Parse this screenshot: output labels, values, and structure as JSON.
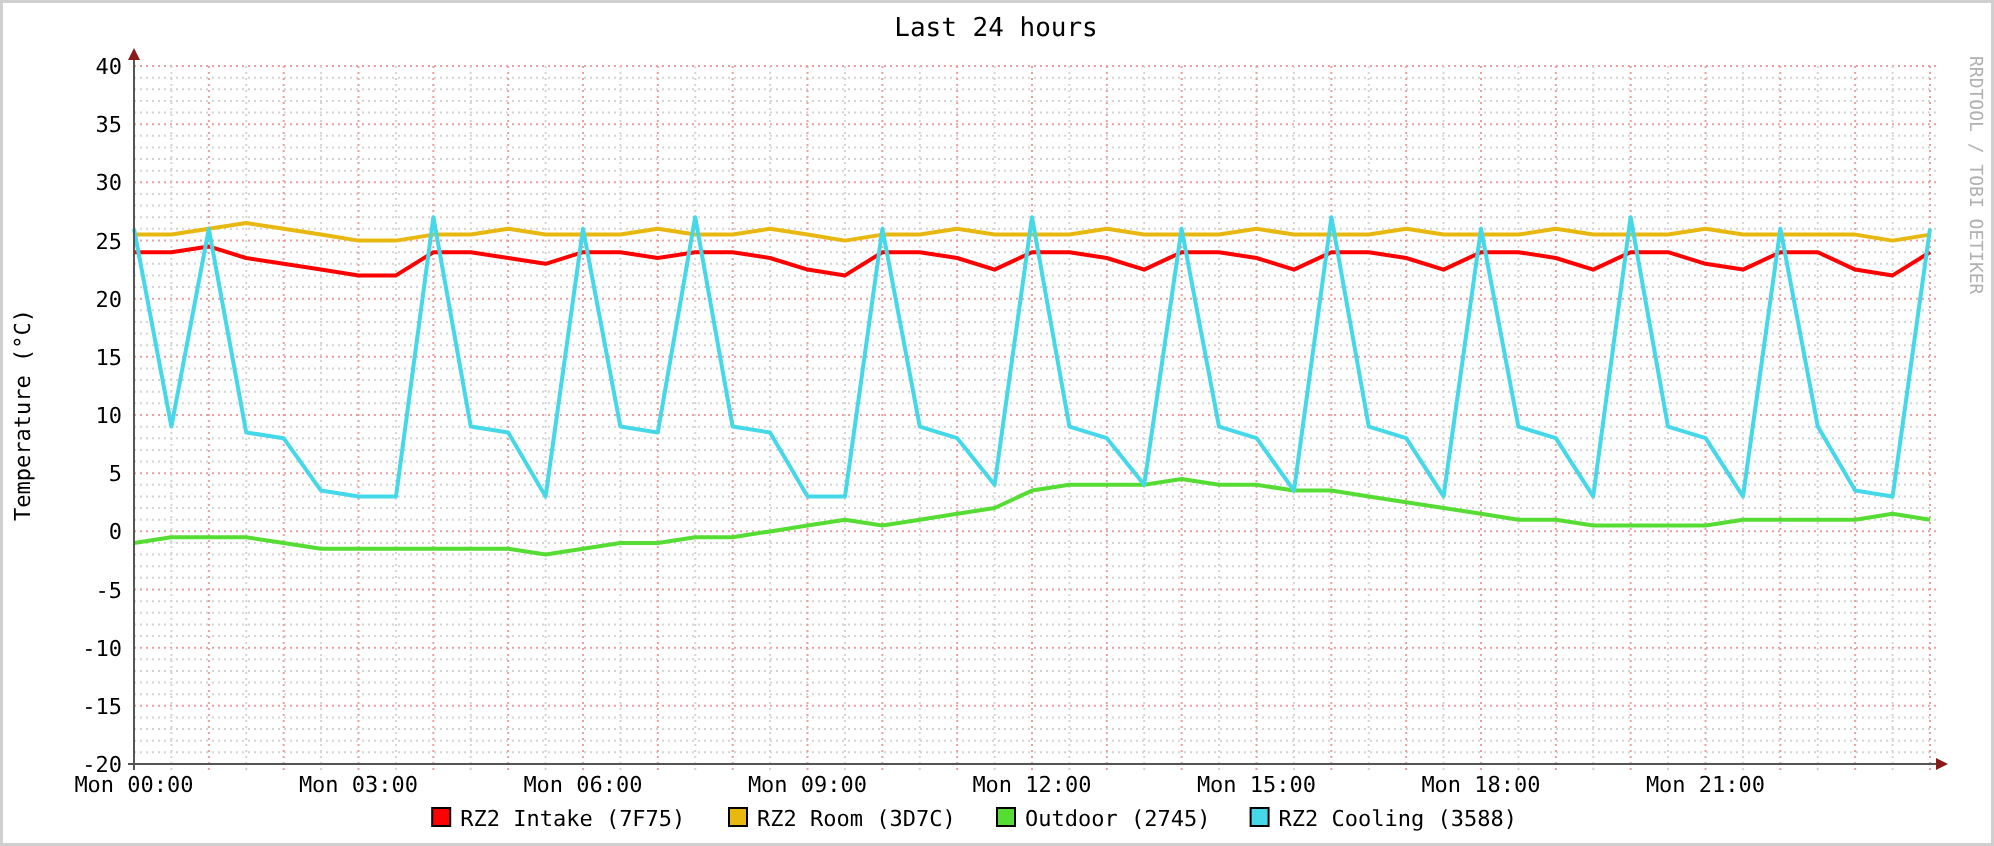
{
  "graph": {
    "credit": "RRDTOOL / TOBI OETIKER",
    "chart_data": {
      "type": "line",
      "title": "Last 24 hours",
      "ylabel": "Temperature (°C)",
      "ylim": [
        -20,
        40
      ],
      "grid": true,
      "legend": "bottom",
      "yticks": [
        -20,
        -15,
        -10,
        -5,
        0,
        5,
        10,
        15,
        20,
        25,
        30,
        35,
        40
      ],
      "categories": [
        "Mon 00:00",
        null,
        null,
        null,
        null,
        null,
        "Mon 03:00",
        null,
        null,
        null,
        null,
        null,
        "Mon 06:00",
        null,
        null,
        null,
        null,
        null,
        "Mon 09:00",
        null,
        null,
        null,
        null,
        null,
        "Mon 12:00",
        null,
        null,
        null,
        null,
        null,
        "Mon 15:00",
        null,
        null,
        null,
        null,
        null,
        "Mon 18:00",
        null,
        null,
        null,
        null,
        null,
        "Mon 21:00",
        null,
        null,
        null,
        null,
        null,
        null
      ],
      "series": [
        {
          "name": "RZ2 Intake (7F75)",
          "color": "#ff0000",
          "values": [
            24,
            24,
            24.5,
            23.5,
            23,
            22.5,
            22,
            22,
            24,
            24,
            23.5,
            23,
            24,
            24,
            23.5,
            24,
            24,
            23.5,
            22.5,
            22,
            24,
            24,
            23.5,
            22.5,
            24,
            24,
            23.5,
            22.5,
            24,
            24,
            23.5,
            22.5,
            24,
            24,
            23.5,
            22.5,
            24,
            24,
            23.5,
            22.5,
            24,
            24,
            23,
            22.5,
            24,
            24,
            22.5,
            22,
            24
          ]
        },
        {
          "name": "RZ2 Room (3D7C)",
          "color": "#e8b810",
          "values": [
            25.5,
            25.5,
            26,
            26.5,
            26,
            25.5,
            25,
            25,
            25.5,
            25.5,
            26,
            25.5,
            25.5,
            25.5,
            26,
            25.5,
            25.5,
            26,
            25.5,
            25,
            25.5,
            25.5,
            26,
            25.5,
            25.5,
            25.5,
            26,
            25.5,
            25.5,
            25.5,
            26,
            25.5,
            25.5,
            25.5,
            26,
            25.5,
            25.5,
            25.5,
            26,
            25.5,
            25.5,
            25.5,
            26,
            25.5,
            25.5,
            25.5,
            25.5,
            25,
            25.5
          ]
        },
        {
          "name": "Outdoor (2745)",
          "color": "#55dd33",
          "values": [
            -1,
            -0.5,
            -0.5,
            -0.5,
            -1,
            -1.5,
            -1.5,
            -1.5,
            -1.5,
            -1.5,
            -1.5,
            -2,
            -1.5,
            -1,
            -1,
            -0.5,
            -0.5,
            0,
            0.5,
            1,
            0.5,
            1,
            1.5,
            2,
            3.5,
            4,
            4,
            4,
            4.5,
            4,
            4,
            3.5,
            3.5,
            3,
            2.5,
            2,
            1.5,
            1,
            1,
            0.5,
            0.5,
            0.5,
            0.5,
            1,
            1,
            1,
            1,
            1.5,
            1
          ]
        },
        {
          "name": "RZ2 Cooling (3588)",
          "color": "#44d8e8",
          "values": [
            26,
            9,
            26,
            8.5,
            8,
            3.5,
            3,
            3,
            27,
            9,
            8.5,
            3,
            26,
            9,
            8.5,
            27,
            9,
            8.5,
            3,
            3,
            26,
            9,
            8,
            4,
            27,
            9,
            8,
            4,
            26,
            9,
            8,
            3.5,
            27,
            9,
            8,
            3,
            26,
            9,
            8,
            3,
            27,
            9,
            8,
            3,
            26,
            9,
            3.5,
            3,
            26
          ]
        }
      ]
    }
  }
}
